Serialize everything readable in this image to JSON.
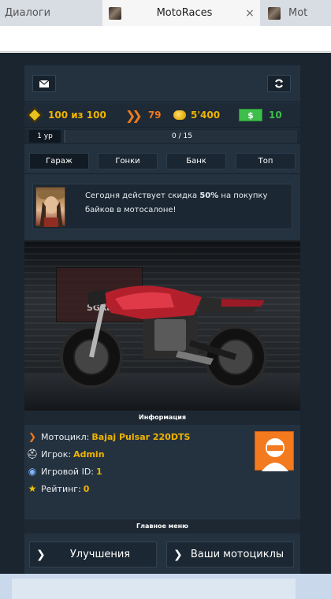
{
  "browser": {
    "tabs": [
      {
        "title": "Диалоги"
      },
      {
        "title": "MotoRaces",
        "close": "×"
      },
      {
        "title": "Mot"
      }
    ]
  },
  "toolbar": {
    "mail_icon": "mail-icon",
    "refresh_icon": "refresh-icon"
  },
  "stats": {
    "energy": "100 из 100",
    "speed": "79",
    "coins": "5'400",
    "cash": "10",
    "cash_symbol": "$"
  },
  "level": {
    "label": "1 ур",
    "progress_text": "0 / 15",
    "progress_fraction": 0
  },
  "nav": {
    "garage": "Гараж",
    "races": "Гонки",
    "bank": "Банк",
    "top": "Топ"
  },
  "promo": {
    "text_before": "Сегодня действует скидка ",
    "discount": "50%",
    "text_after": " на покупку байков в мотосалоне!"
  },
  "garage_scene": {
    "poster_text": "SGRac"
  },
  "info": {
    "header": "Информация",
    "moto_label": "Мотоцикл:",
    "moto_value": "Bajaj Pulsar 220DTS",
    "player_label": "Игрок:",
    "player_value": "Admin",
    "id_label": "Игровой ID:",
    "id_value": "1",
    "rating_label": "Рейтинг:",
    "rating_value": "0"
  },
  "main_menu": {
    "header": "Главное меню",
    "upgrades": "Улучшения",
    "my_bikes": "Ваши мотоциклы"
  },
  "colors": {
    "accent": "#f0b400",
    "speed": "#f07b1a",
    "cash": "#3dbf4a",
    "panel": "#243240"
  }
}
